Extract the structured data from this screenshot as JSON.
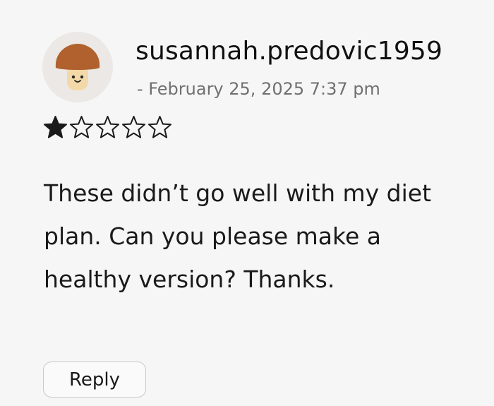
{
  "review": {
    "username": "susannah.predovic1959",
    "timestamp": "- February 25, 2025 7:37 pm",
    "rating": 1,
    "rating_max": 5,
    "body": "These didn’t go well with my diet plan. Can you please make a healthy version? Thanks.",
    "avatar_icon": "mushroom-icon",
    "reply_label": "Reply"
  },
  "colors": {
    "background": "#f6f6f6",
    "avatar_background": "#ebe8e6",
    "mushroom_cap": "#b0612e",
    "mushroom_stem": "#f3d9a8",
    "meta_text": "#707070",
    "star": "#1a1a1a"
  }
}
